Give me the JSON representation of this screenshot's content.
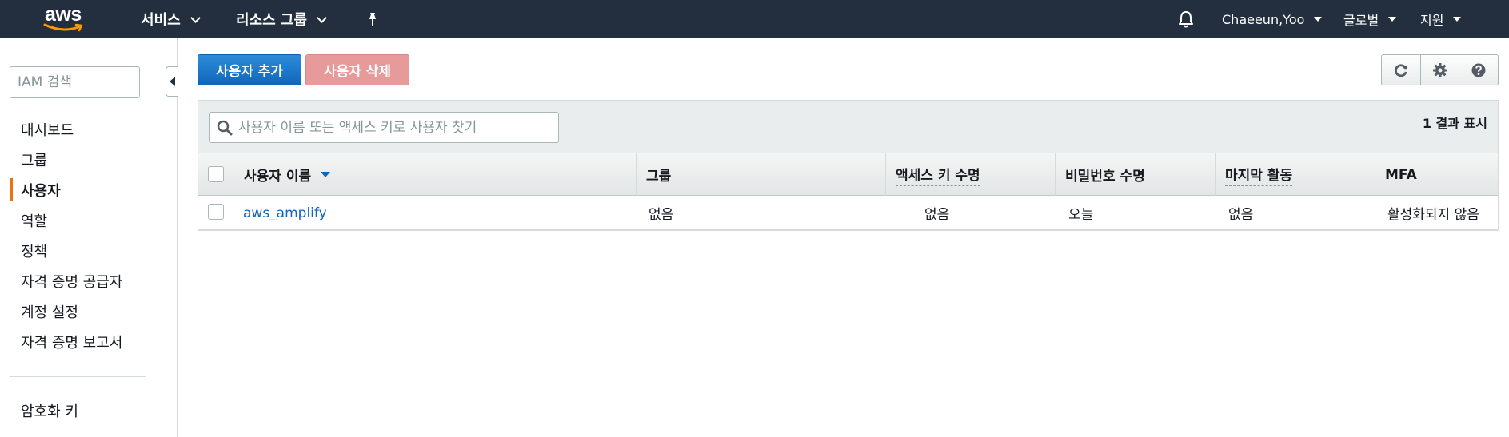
{
  "topnav": {
    "logo_text": "aws",
    "services_label": "서비스",
    "resource_groups_label": "리소스 그룹",
    "user_label": "Chaeeun,Yoo",
    "region_label": "글로벌",
    "support_label": "지원"
  },
  "sidebar": {
    "search_placeholder": "IAM 검색",
    "items": [
      {
        "label": "대시보드"
      },
      {
        "label": "그룹"
      },
      {
        "label": "사용자"
      },
      {
        "label": "역할"
      },
      {
        "label": "정책"
      },
      {
        "label": "자격 증명 공급자"
      },
      {
        "label": "계정 설정"
      },
      {
        "label": "자격 증명 보고서"
      }
    ],
    "encryption_keys_label": "암호화 키"
  },
  "toolbar": {
    "add_user_label": "사용자 추가",
    "delete_user_label": "사용자 삭제"
  },
  "table": {
    "search_placeholder": "사용자 이름 또는 액세스 키로 사용자 찾기",
    "result_count": "1 결과 표시",
    "columns": [
      "사용자 이름",
      "그룹",
      "액세스 키 수명",
      "비밀번호 수명",
      "마지막 활동",
      "MFA"
    ],
    "rows": [
      {
        "user_name": "aws_amplify",
        "groups": "없음",
        "access_key_age": "없음",
        "password_age": "오늘",
        "last_activity": "없음",
        "mfa": "활성화되지 않음"
      }
    ]
  },
  "colors": {
    "nav_bg": "#232f3e",
    "primary": "#1166bb",
    "danger_disabled": "#e79a9a",
    "active_indicator": "#ec7211"
  }
}
